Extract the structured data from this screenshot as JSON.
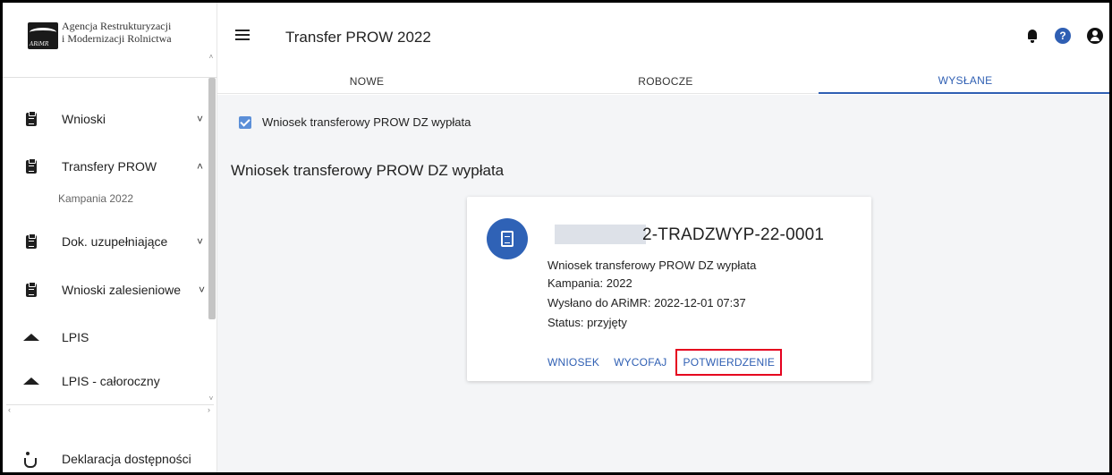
{
  "logo": {
    "line1": "Agencja Restrukturyzacji",
    "line2": "i Modernizacji Rolnictwa",
    "mark_text": "ARiMR"
  },
  "header": {
    "title": "Transfer PROW 2022"
  },
  "tabs": [
    {
      "label": "NOWE",
      "active": false
    },
    {
      "label": "ROBOCZE",
      "active": false
    },
    {
      "label": "WYSŁANE",
      "active": true
    }
  ],
  "sidebar": {
    "items": [
      {
        "label": "Wnioski",
        "icon": "clipboard-icon",
        "chevron": "˅"
      },
      {
        "label": "Transfery PROW",
        "icon": "clipboard-icon",
        "chevron": "˄"
      },
      {
        "label": "Dok. uzupełniające",
        "icon": "clipboard-icon",
        "chevron": "˅"
      },
      {
        "label": "Wnioski zalesieniowe",
        "icon": "clipboard-icon",
        "chevron": "˅"
      },
      {
        "label": "LPIS",
        "icon": "mountain-icon"
      },
      {
        "label": "LPIS - całoroczny",
        "icon": "mountain-icon"
      }
    ],
    "sub_item": "Kampania 2022",
    "footer_item": "Deklaracja dostępności"
  },
  "filter": {
    "label": "Wniosek transferowy PROW DZ wypłata",
    "checked": true
  },
  "section_title": "Wniosek transferowy PROW DZ wypłata",
  "card": {
    "id_suffix": "2-TRADZWYP-22-0001",
    "type": "Wniosek transferowy PROW DZ wypłata",
    "campaign": "Kampania: 2022",
    "sent": "Wysłano do ARiMR: 2022-12-01 07:37",
    "status": "Status: przyjęty",
    "actions": [
      "WNIOSEK",
      "WYCOFAJ",
      "POTWIERDZENIE"
    ]
  },
  "colors": {
    "accent": "#2f5fb3",
    "highlight": "#e5001e",
    "background": "#f4f5f7"
  }
}
